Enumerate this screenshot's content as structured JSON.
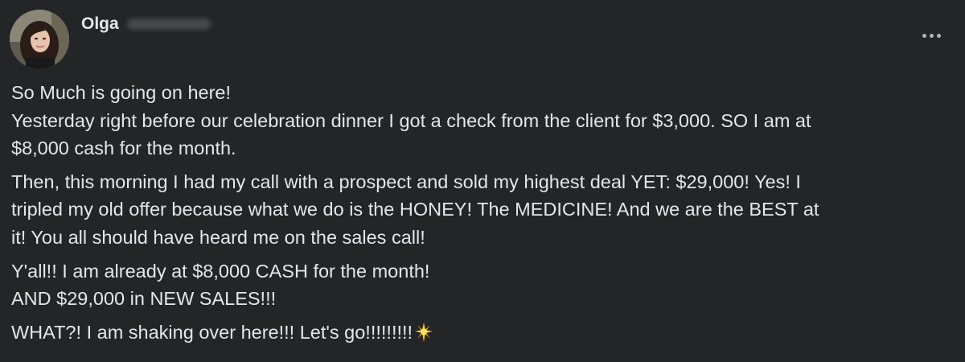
{
  "post": {
    "author": {
      "first_name": "Olga",
      "avatar_icon": "profile-photo"
    },
    "menu_icon": "more-options-icon",
    "paragraphs": [
      {
        "lines": [
          "So Much is going on here!",
          "Yesterday right before our celebration dinner I got a check from the client for $3,000. SO I am at",
          "$8,000 cash for the month."
        ]
      },
      {
        "lines": [
          "Then, this morning I had my call with a prospect and sold my highest deal YET: $29,000! Yes! I",
          "tripled my old offer because what we do is the HONEY! The MEDICINE! And we are the BEST at",
          "it! You all should have heard me on the sales call!"
        ]
      },
      {
        "lines": [
          "Y'all!! I am already at $8,000 CASH for the month!",
          "AND $29,000 in NEW SALES!!!"
        ]
      },
      {
        "lines": [
          "WHAT?! I am shaking over here!!! Let's go!!!!!!!!!"
        ],
        "trailing_icon": "sparkle-emoji"
      }
    ]
  },
  "colors": {
    "background": "#242526",
    "text_primary": "#e4e6eb",
    "text_secondary": "#b0b3b8"
  }
}
